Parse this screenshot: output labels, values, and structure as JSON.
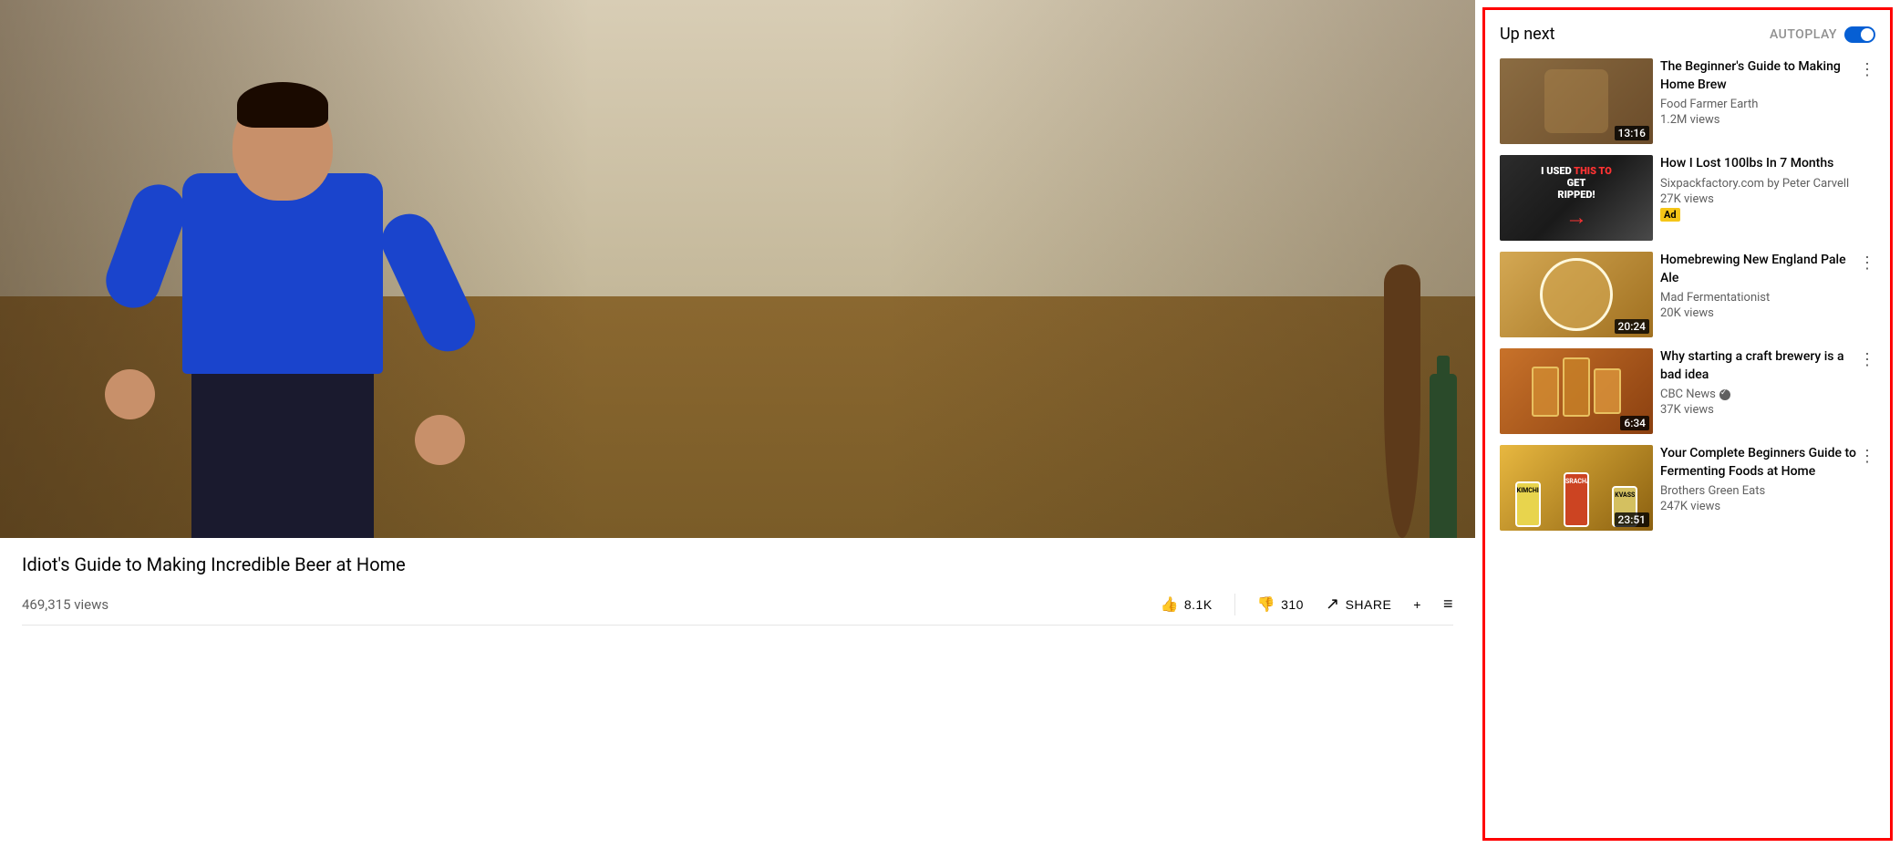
{
  "main": {
    "video": {
      "title": "Idiot's Guide to Making Incredible Beer at Home",
      "views": "469,315 views"
    },
    "actions": {
      "like_label": "8.1K",
      "dislike_label": "310",
      "share_label": "SHARE",
      "add_label": "+"
    }
  },
  "upnext": {
    "header_title": "Up next",
    "autoplay_label": "AUTOPLAY",
    "cards": [
      {
        "id": 1,
        "title": "The Beginner's Guide to Making Home Brew",
        "channel": "Food Farmer Earth",
        "views": "1.2M views",
        "duration": "13:16",
        "thumb_class": "thumb-1",
        "is_ad": false,
        "verified": false
      },
      {
        "id": 2,
        "title": "How I Lost 100lbs In 7 Months",
        "channel": "Sixpackfactory.com by Peter Carvell",
        "views": "27K views",
        "duration": "",
        "thumb_class": "thumb-2",
        "is_ad": true,
        "verified": false
      },
      {
        "id": 3,
        "title": "Homebrewing New England Pale Ale",
        "channel": "Mad Fermentationist",
        "views": "20K views",
        "duration": "20:24",
        "thumb_class": "thumb-3",
        "is_ad": false,
        "verified": false
      },
      {
        "id": 4,
        "title": "Why starting a craft brewery is a bad idea",
        "channel": "CBC News",
        "views": "37K views",
        "duration": "6:34",
        "thumb_class": "thumb-4",
        "is_ad": false,
        "verified": true
      },
      {
        "id": 5,
        "title": "Your Complete Beginners Guide to Fermenting Foods at Home",
        "channel": "Brothers Green Eats",
        "views": "247K views",
        "duration": "23:51",
        "thumb_class": "thumb-5",
        "is_ad": false,
        "verified": false
      }
    ]
  }
}
